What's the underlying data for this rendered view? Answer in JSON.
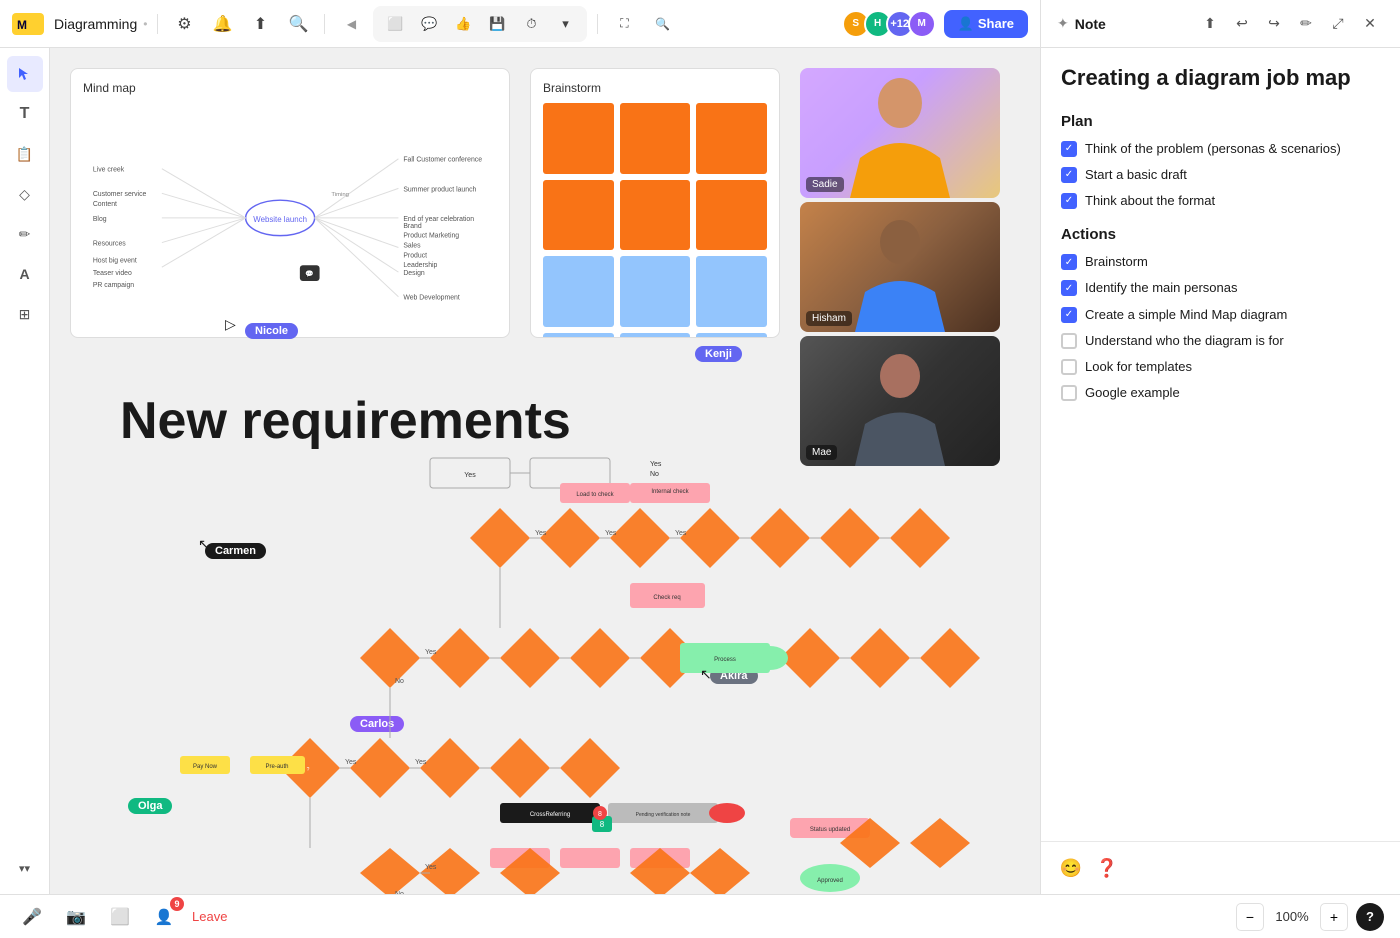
{
  "app": {
    "logo": "miro",
    "board_title": "Diagramming"
  },
  "toolbar": {
    "tools": [
      "select",
      "text",
      "sticky",
      "shapes",
      "pen",
      "text-large",
      "frame",
      "more"
    ],
    "nav_back": "◀",
    "nav_forward": "▶",
    "tool_icons": [
      "⬜",
      "💬",
      "👍",
      "💾",
      "⏱",
      "▾"
    ],
    "right_icons": [
      "⛶",
      "🔍"
    ],
    "share_label": "Share"
  },
  "avatars": [
    {
      "initials": "S",
      "color": "#f59e0b"
    },
    {
      "initials": "H",
      "color": "#10b981"
    },
    {
      "initials": "+12",
      "color": "#6366f1"
    },
    {
      "initials": "M",
      "color": "#8b5cf6"
    }
  ],
  "canvas": {
    "panels": {
      "mind_map": {
        "label": "Mind map"
      },
      "brainstorm": {
        "label": "Brainstorm"
      }
    },
    "videos": [
      {
        "name": "Sadie"
      },
      {
        "name": "Hisham"
      },
      {
        "name": "Mae"
      }
    ],
    "text_element": "New requirements",
    "user_labels": [
      {
        "name": "Nicole",
        "color": "#6366f1"
      },
      {
        "name": "Kenji",
        "color": "#6366f1"
      },
      {
        "name": "Carmen",
        "color": "#1a1a1a"
      },
      {
        "name": "Akira",
        "color": "#6b7280"
      },
      {
        "name": "Carlos",
        "color": "#8b5cf6"
      },
      {
        "name": "Olga",
        "color": "#10b981"
      }
    ]
  },
  "note_panel": {
    "title": "Note",
    "main_title": "Creating a diagram job map",
    "sections": [
      {
        "heading": "Plan",
        "items": [
          {
            "label": "Think of the problem (personas & scenarios)",
            "checked": true
          },
          {
            "label": "Start a basic draft",
            "checked": true
          },
          {
            "label": "Think about the format",
            "checked": true
          }
        ]
      },
      {
        "heading": "Actions",
        "items": [
          {
            "label": "Brainstorm",
            "checked": true
          },
          {
            "label": "Identify the main personas",
            "checked": true
          },
          {
            "label": "Create a simple Mind Map diagram",
            "checked": true
          },
          {
            "label": "Understand who the diagram is for",
            "checked": false
          },
          {
            "label": "Look for templates",
            "checked": false
          },
          {
            "label": "Google example",
            "checked": false
          }
        ]
      }
    ]
  },
  "bottom_bar": {
    "leave_label": "Leave",
    "zoom": "100%",
    "zoom_plus": "+",
    "zoom_minus": "−",
    "help": "?"
  }
}
